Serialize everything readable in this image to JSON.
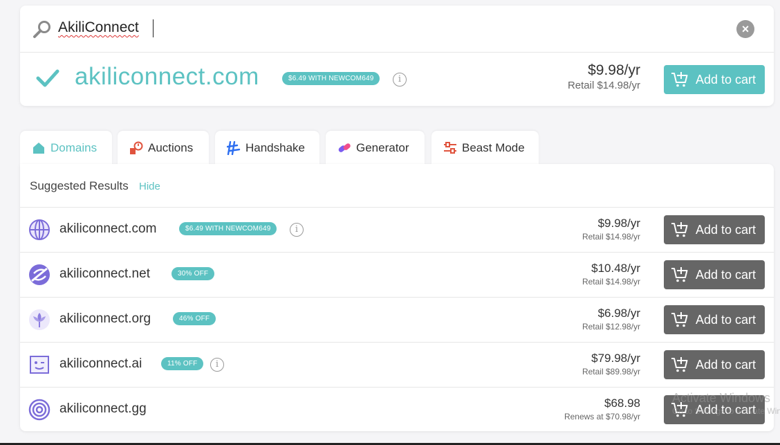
{
  "search": {
    "query": "AkiliConnect",
    "icon": "search-icon",
    "clear_icon": "close-icon"
  },
  "hero": {
    "domain": "akiliconnect.com",
    "badge": "$6.49 WITH NEWCOM649",
    "price": "$9.98/yr",
    "retail": "Retail $14.98/yr",
    "cart_label": "Add to cart",
    "accent": "#5cc2c2"
  },
  "tabs": [
    {
      "label": "Domains",
      "icon": "home-icon",
      "active": true
    },
    {
      "label": "Auctions",
      "icon": "auction-icon"
    },
    {
      "label": "Handshake",
      "icon": "handshake-icon"
    },
    {
      "label": "Generator",
      "icon": "generator-icon"
    },
    {
      "label": "Beast Mode",
      "icon": "sliders-icon"
    }
  ],
  "results": {
    "title": "Suggested Results",
    "hide_label": "Hide",
    "rows": [
      {
        "domain": "akiliconnect.com",
        "badge": "$6.49 WITH NEWCOM649",
        "info": true,
        "price": "$9.98/yr",
        "retail": "Retail $14.98/yr",
        "cart_label": "Add to cart",
        "icon": "globe-icon"
      },
      {
        "domain": "akiliconnect.net",
        "badge": "30% OFF",
        "info": false,
        "price": "$10.48/yr",
        "retail": "Retail $14.98/yr",
        "cart_label": "Add to cart",
        "icon": "net-icon"
      },
      {
        "domain": "akiliconnect.org",
        "badge": "46% OFF",
        "info": false,
        "price": "$6.98/yr",
        "retail": "Retail $12.98/yr",
        "cart_label": "Add to cart",
        "icon": "lotus-icon"
      },
      {
        "domain": "akiliconnect.ai",
        "badge": "11% OFF",
        "info": true,
        "price": "$79.98/yr",
        "retail": "Retail $89.98/yr",
        "cart_label": "Add to cart",
        "icon": "robot-icon"
      },
      {
        "domain": "akiliconnect.gg",
        "badge": "",
        "info": false,
        "price": "$68.98",
        "retail": "Renews at $70.98/yr",
        "cart_label": "Add to cart",
        "icon": "target-icon"
      }
    ]
  },
  "watermark": {
    "line1": "Activate Windows",
    "line2": "Go to Settings to activate Windows."
  }
}
